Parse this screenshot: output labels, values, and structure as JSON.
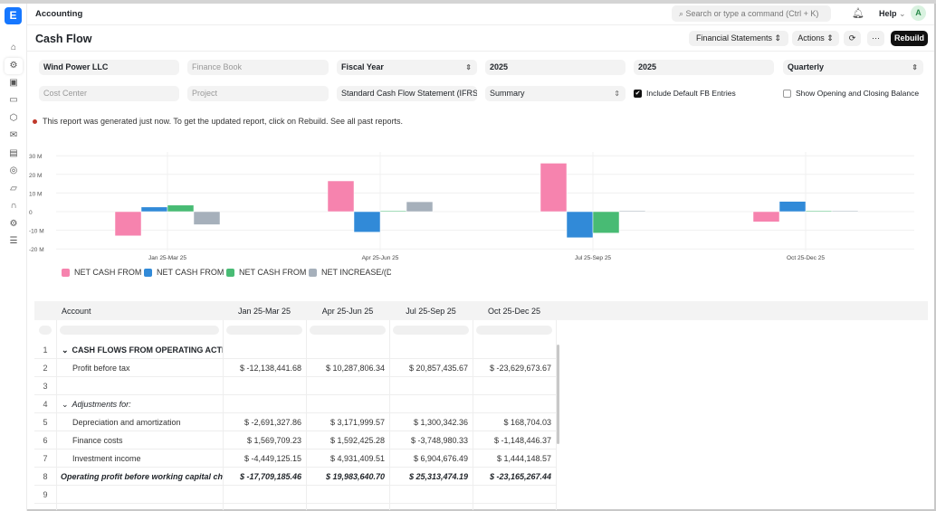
{
  "app": {
    "title": "Accounting",
    "logo": "E"
  },
  "header": {
    "search_placeholder": "Search or type a command (Ctrl + K)",
    "help_label": "Help",
    "avatar_initial": "A"
  },
  "sidebar": {
    "icons": [
      "home-icon",
      "accounting-icon",
      "briefcase-icon",
      "card-icon",
      "package-icon",
      "inbox-icon",
      "building-icon",
      "badge-icon",
      "folder-icon",
      "headset-icon",
      "settings-icon",
      "server-icon"
    ]
  },
  "page": {
    "title": "Cash Flow",
    "financial_statements_label": "Financial Statements",
    "actions_label": "Actions",
    "more_label": "···",
    "rebuild_label": "Rebuild"
  },
  "filters": {
    "company": "Wind Power LLC",
    "finance_book_placeholder": "Finance Book",
    "period_basis": "Fiscal Year",
    "from_year": "2025",
    "to_year": "2025",
    "periodicity": "Quarterly",
    "cost_center_placeholder": "Cost Center",
    "project_placeholder": "Project",
    "report_template": "Standard Cash Flow Statement (IFRS)",
    "view": "Summary",
    "include_default_fb_label": "Include Default FB Entries",
    "include_default_fb": true,
    "show_opening_closing_label": "Show Opening and Closing Balance",
    "show_opening_closing": false
  },
  "notice": "This report was generated just now. To get the updated report, click on Rebuild. See all past reports.",
  "chart_data": {
    "type": "bar",
    "categories": [
      "Jan 25-Mar 25",
      "Apr 25-Jun 25",
      "Jul 25-Sep 25",
      "Oct 25-Dec 25"
    ],
    "ylim": [
      -20,
      30
    ],
    "yticks": [
      "30 M",
      "20 M",
      "10 M",
      "0",
      "-10 M",
      "-20 M"
    ],
    "yticks_values": [
      30,
      20,
      10,
      0,
      -10,
      -20
    ],
    "grid": true,
    "legend_position": "bottom-left",
    "series": [
      {
        "name": "NET CASH FROM O...",
        "color": "#f683ae",
        "values": [
          -13,
          16.5,
          26,
          -5.5
        ]
      },
      {
        "name": "NET CASH FROM I...",
        "color": "#318ad8",
        "values": [
          2.5,
          -11,
          -14,
          5.5
        ]
      },
      {
        "name": "NET CASH FROM F...",
        "color": "#48bb74",
        "values": [
          3.5,
          0.1,
          -11.5,
          0.3
        ]
      },
      {
        "name": "NET INCREASE/(D...",
        "color": "#a6b0bb",
        "values": [
          -7,
          5.3,
          0.5,
          0.3
        ]
      }
    ]
  },
  "table": {
    "columns": [
      "Account",
      "Jan 25-Mar 25",
      "Apr 25-Jun 25",
      "Jul 25-Sep 25",
      "Oct 25-Dec 25"
    ],
    "rows": [
      {
        "n": "1",
        "account": "CASH FLOWS FROM OPERATING ACTIVITIES",
        "style": "group",
        "values": [
          "",
          "",
          "",
          ""
        ]
      },
      {
        "n": "2",
        "account": "Profit before tax",
        "style": "item",
        "values": [
          "$ -12,138,441.68",
          "$ 10,287,806.34",
          "$ 20,857,435.67",
          "$ -23,629,673.67"
        ]
      },
      {
        "n": "3",
        "account": "",
        "style": "item",
        "values": [
          "",
          "",
          "",
          ""
        ]
      },
      {
        "n": "4",
        "account": "Adjustments for:",
        "style": "subgroup",
        "values": [
          "",
          "",
          "",
          ""
        ]
      },
      {
        "n": "5",
        "account": "Depreciation and amortization",
        "style": "item",
        "values": [
          "$ -2,691,327.86",
          "$ 3,171,999.57",
          "$ 1,300,342.36",
          "$ 168,704.03"
        ]
      },
      {
        "n": "6",
        "account": "Finance costs",
        "style": "item",
        "values": [
          "$ 1,569,709.23",
          "$ 1,592,425.28",
          "$ -3,748,980.33",
          "$ -1,148,446.37"
        ]
      },
      {
        "n": "7",
        "account": "Investment income",
        "style": "item",
        "values": [
          "$ -4,449,125.15",
          "$ 4,931,409.51",
          "$ 6,904,676.49",
          "$ 1,444,148.57"
        ]
      },
      {
        "n": "8",
        "account": "Operating profit before working capital changes",
        "style": "total",
        "values": [
          "$ -17,709,185.46",
          "$ 19,983,640.70",
          "$ 25,313,474.19",
          "$ -23,165,267.44"
        ]
      },
      {
        "n": "9",
        "account": "",
        "style": "item",
        "values": [
          "",
          "",
          "",
          ""
        ]
      }
    ]
  }
}
